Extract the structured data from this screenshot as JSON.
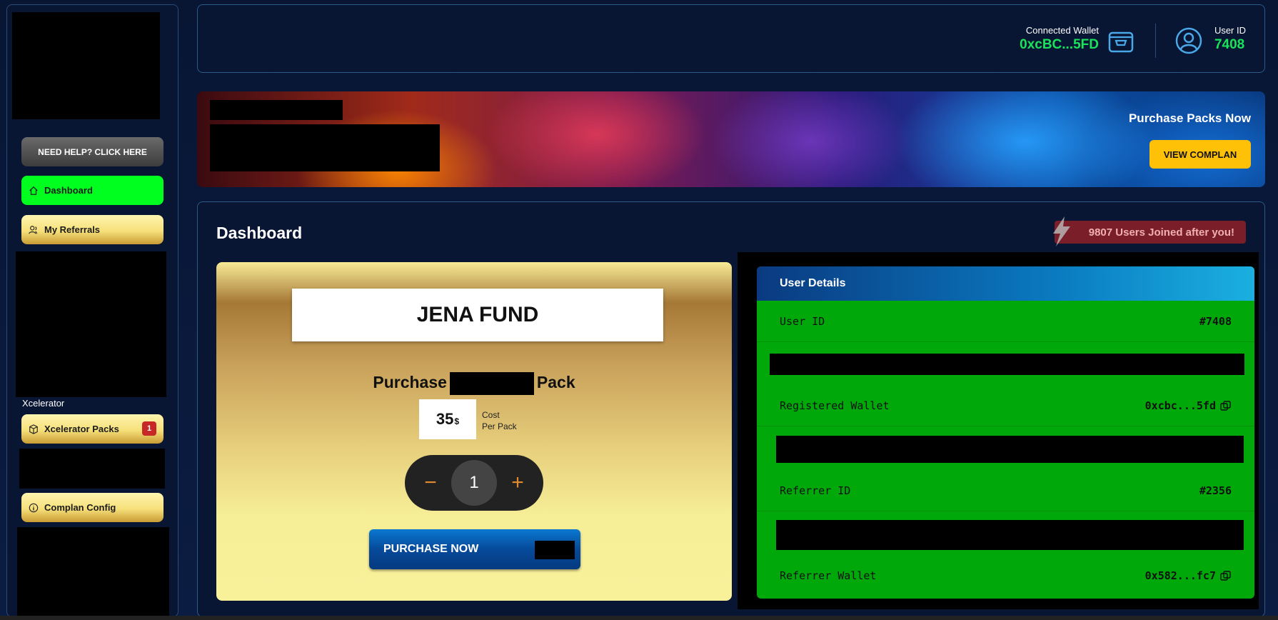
{
  "sidebar": {
    "help_label": "NEED HELP? CLICK HERE",
    "items": [
      {
        "label": "Dashboard",
        "icon": "home-icon"
      },
      {
        "label": "My Referrals",
        "icon": "users-icon"
      },
      {
        "label": "Xcelerator Packs",
        "icon": "package-icon",
        "badge": "1"
      },
      {
        "label": "Complan Config",
        "icon": "info-icon"
      }
    ],
    "section_label": "Xcelerator"
  },
  "header": {
    "wallet_label": "Connected Wallet",
    "wallet_value": "0xcBC...5FD",
    "user_label": "User ID",
    "user_value": "7408"
  },
  "banner": {
    "title": "Purchase Packs Now",
    "button_label": "VIEW COMPLAN"
  },
  "main": {
    "title": "Dashboard",
    "joined_text": "9807 Users Joined after you!",
    "purchase_card": {
      "fund_name": "JENA FUND",
      "purchase_prefix": "Purchase",
      "purchase_suffix": "Pack",
      "price": "35",
      "currency": "$",
      "cost_label_1": "Cost",
      "cost_label_2": "Per Pack",
      "quantity": "1",
      "decrement": "−",
      "increment": "+",
      "button_label": "PURCHASE NOW"
    },
    "user_details": {
      "title": "User Details",
      "rows": [
        {
          "label": "User ID",
          "value": "#7408"
        },
        {
          "label": "Registered Wallet",
          "value": "0xcbc...5fd"
        },
        {
          "label": "Referrer ID",
          "value": "#2356"
        },
        {
          "label": "Referrer Wallet",
          "value": "0x582...fc7"
        }
      ]
    }
  },
  "colors": {
    "accent_green": "#19e35a",
    "active_nav": "#00ff1e",
    "banner_button": "#ffc107",
    "details_bg": "#00a80a"
  }
}
